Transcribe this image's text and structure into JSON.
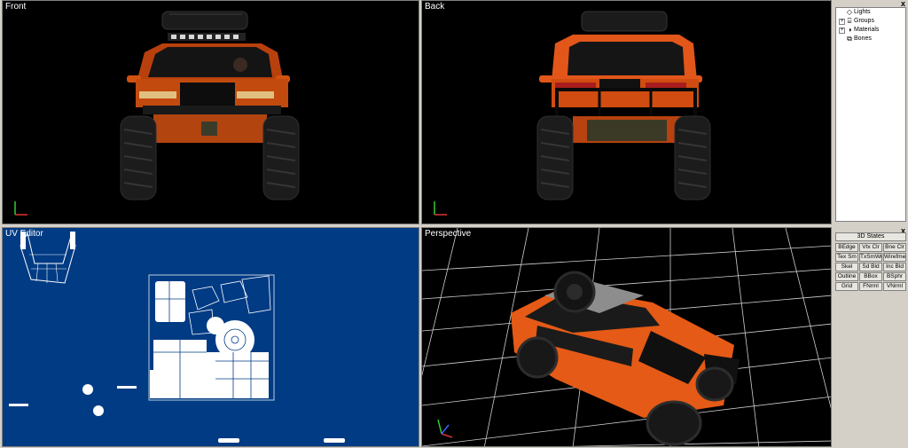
{
  "viewports": {
    "front": {
      "label": "Front"
    },
    "back": {
      "label": "Back"
    },
    "uv": {
      "label": "UV Editor"
    },
    "perspective": {
      "label": "Perspective"
    }
  },
  "scene_tree": {
    "close_label": "x",
    "items": [
      {
        "label": "Lights",
        "expandable": false,
        "icon": "diamond-icon"
      },
      {
        "label": "Groups",
        "expandable": true,
        "icon": "cylinder-icon"
      },
      {
        "label": "Materials",
        "expandable": true,
        "icon": "sphere-icon"
      },
      {
        "label": "Bones",
        "expandable": false,
        "icon": "bone-icon"
      }
    ]
  },
  "states_panel": {
    "close_label": "x",
    "title": "3D States",
    "buttons": [
      "BEdge",
      "Vtx Clr",
      "Bne Clr",
      "Tex Sm",
      "TxSmWr",
      "Wirefme",
      "Skel",
      "Sd Bld",
      "Inc Bld",
      "Outline",
      "BBox",
      "BSphr",
      "Grid",
      "FNrml",
      "VNrml"
    ]
  },
  "colors": {
    "truck_orange": "#e0500e",
    "uv_background": "#003b84",
    "viewport_background": "#000000",
    "grid_line": "#ffffff"
  }
}
